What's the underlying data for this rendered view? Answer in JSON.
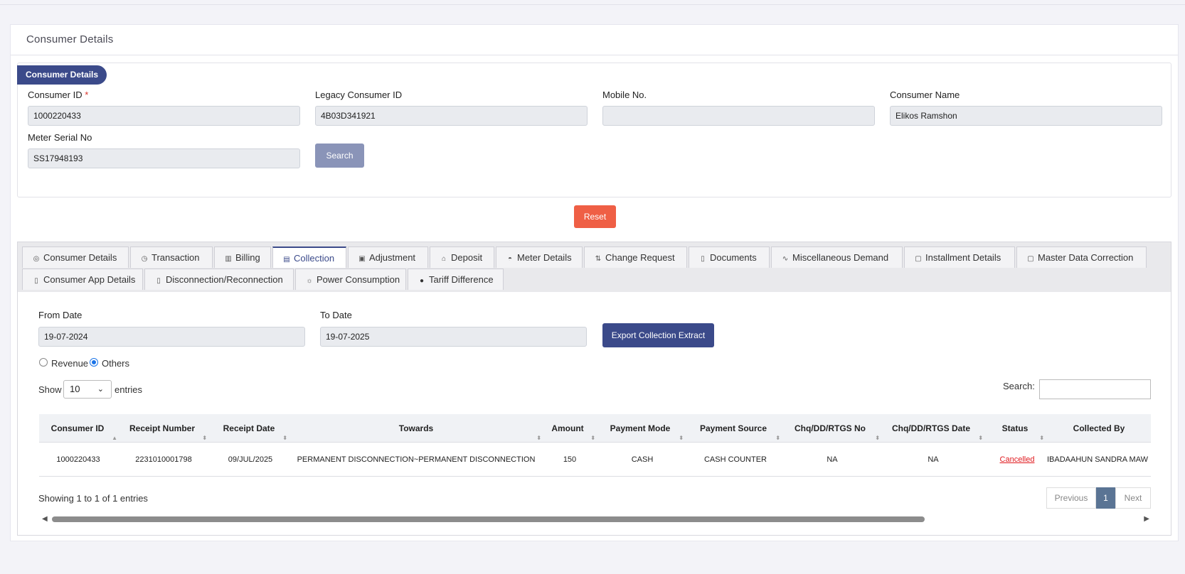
{
  "page_title": "Consumer Details",
  "section_legend": "Consumer Details",
  "fields": {
    "consumer_id": {
      "label": "Consumer ID",
      "required_mark": "*",
      "value": "1000220433"
    },
    "legacy_consumer_id": {
      "label": "Legacy Consumer ID",
      "value": "4B03D341921"
    },
    "mobile_no": {
      "label": "Mobile No.",
      "value": ""
    },
    "consumer_name": {
      "label": "Consumer Name",
      "value": "Elikos Ramshon"
    },
    "meter_serial_no": {
      "label": "Meter Serial No",
      "value": "SS17948193"
    }
  },
  "buttons": {
    "search": "Search",
    "reset": "Reset",
    "export": "Export Collection Extract"
  },
  "tabs": [
    {
      "label": "Consumer Details",
      "icon": "eye-icon"
    },
    {
      "label": "Transaction",
      "icon": "clock-icon"
    },
    {
      "label": "Billing",
      "icon": "chart-icon"
    },
    {
      "label": "Collection",
      "icon": "list-icon",
      "active": true
    },
    {
      "label": "Adjustment",
      "icon": "image-icon"
    },
    {
      "label": "Deposit",
      "icon": "bank-icon"
    },
    {
      "label": "Meter Details",
      "icon": "gauge-icon"
    },
    {
      "label": "Change Request",
      "icon": "swap-icon"
    },
    {
      "label": "Documents",
      "icon": "document-icon"
    },
    {
      "label": "Miscellaneous Demand",
      "icon": "pulse-icon"
    },
    {
      "label": "Installment Details",
      "icon": "box-icon"
    },
    {
      "label": "Master Data Correction",
      "icon": "box-icon"
    },
    {
      "label": "Consumer App Details",
      "icon": "phone-icon"
    },
    {
      "label": "Disconnection/Reconnection",
      "icon": "phone-icon"
    },
    {
      "label": "Power Consumption",
      "icon": "bulb-icon"
    },
    {
      "label": "Tariff Difference",
      "icon": "circle-icon"
    }
  ],
  "filters": {
    "from_date": {
      "label": "From Date",
      "value": "19-07-2024"
    },
    "to_date": {
      "label": "To Date",
      "value": "19-07-2025"
    },
    "radio_revenue": "Revenue",
    "radio_others": "Others",
    "selected_radio": "Others"
  },
  "table_controls": {
    "show": "Show",
    "entries_value": "10",
    "entries": "entries",
    "search_label": "Search:"
  },
  "table": {
    "columns": [
      "Consumer ID",
      "Receipt Number",
      "Receipt Date",
      "Towards",
      "Amount",
      "Payment Mode",
      "Payment Source",
      "Chq/DD/RTGS No",
      "Chq/DD/RTGS Date",
      "Status",
      "Collected By"
    ],
    "rows": [
      [
        "1000220433",
        "2231010001798",
        "09/JUL/2025",
        "PERMANENT DISCONNECTION~PERMANENT DISCONNECTION",
        "150",
        "CASH",
        "CASH COUNTER",
        "NA",
        "NA",
        "Cancelled",
        "IBADAAHUN SANDRA MAW"
      ]
    ]
  },
  "pagination": {
    "info": "Showing 1 to 1 of 1 entries",
    "previous": "Previous",
    "current": "1",
    "next": "Next"
  },
  "colors": {
    "primary": "#3b4a8a",
    "reset": "#ef5f45",
    "status_cancelled": "#e0181d"
  }
}
